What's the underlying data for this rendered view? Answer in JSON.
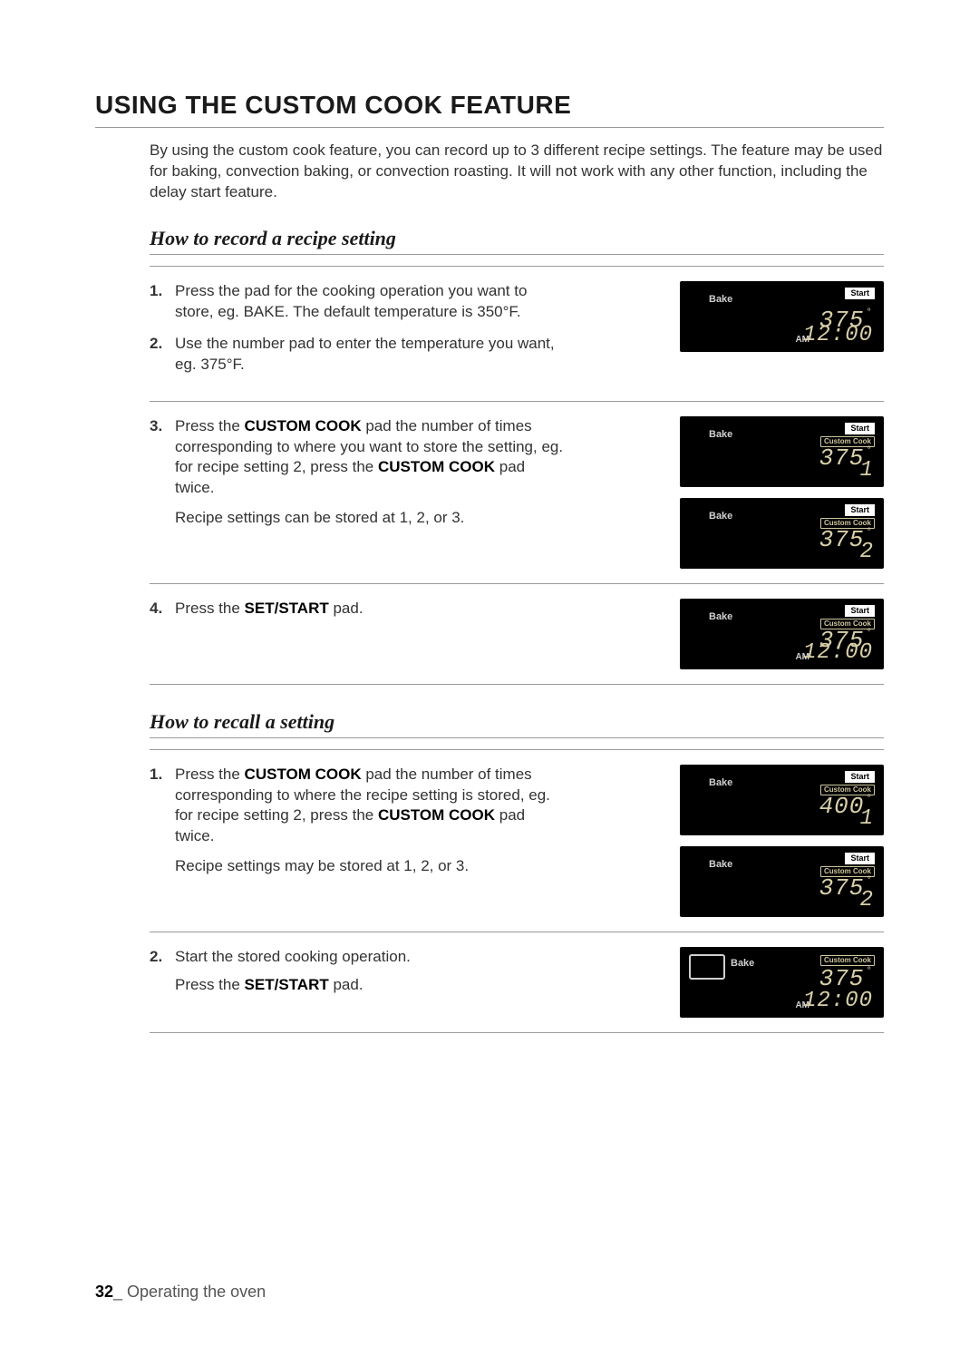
{
  "title": "USING THE CUSTOM COOK FEATURE",
  "intro": "By using the custom cook feature, you can record up to 3 different recipe settings. The feature may be used for baking, convection baking, or convection roasting. It will not work with any other function, including the delay start feature.",
  "section_record": "How to record a recipe setting",
  "section_recall": "How to recall a setting",
  "labels": {
    "bake": "Bake",
    "start": "Start",
    "custom_cook": "Custom Cook",
    "am": "AM"
  },
  "record_steps": {
    "s1_n": "1.",
    "s1": "Press the pad for the cooking operation you want to store, eg. BAKE. The default temperature is 350°F.",
    "s2_n": "2.",
    "s2": "Use the number pad to enter the temperature you want, eg. 375°F.",
    "s3_n": "3.",
    "s3a": "Press the ",
    "s3b": "CUSTOM COOK",
    "s3c": " pad the number of times corresponding to where you want to store the setting, eg. for recipe setting 2, press the ",
    "s3d": "CUSTOM COOK",
    "s3e": " pad twice.",
    "s3_note": "Recipe settings can be stored at 1, 2, or 3.",
    "s4_n": "4.",
    "s4a": "Press the ",
    "s4b": "SET/START",
    "s4c": " pad."
  },
  "recall_steps": {
    "s1_n": "1.",
    "s1a": "Press the ",
    "s1b": "CUSTOM COOK",
    "s1c": " pad the number of times corresponding to where the recipe setting is stored, eg. for recipe setting 2, press the ",
    "s1d": "CUSTOM COOK",
    "s1e": " pad twice.",
    "s1_note": "Recipe settings may be stored at 1, 2, or 3.",
    "s2_n": "2.",
    "s2": "Start the stored cooking operation.",
    "s2a": "Press the ",
    "s2b": "SET/START",
    "s2c": " pad."
  },
  "displays": {
    "d1": {
      "temp": "375",
      "clock": "12:00"
    },
    "d2": {
      "temp": "375",
      "slot": "1"
    },
    "d3": {
      "temp": "375",
      "slot": "2"
    },
    "d4": {
      "temp": "375",
      "clock": "12:00"
    },
    "d5": {
      "temp": "400",
      "slot": "1"
    },
    "d6": {
      "temp": "375",
      "slot": "2"
    },
    "d7": {
      "temp": "375",
      "clock": "12:00"
    }
  },
  "footer": {
    "page": "32",
    "section": "_ Operating the oven"
  }
}
